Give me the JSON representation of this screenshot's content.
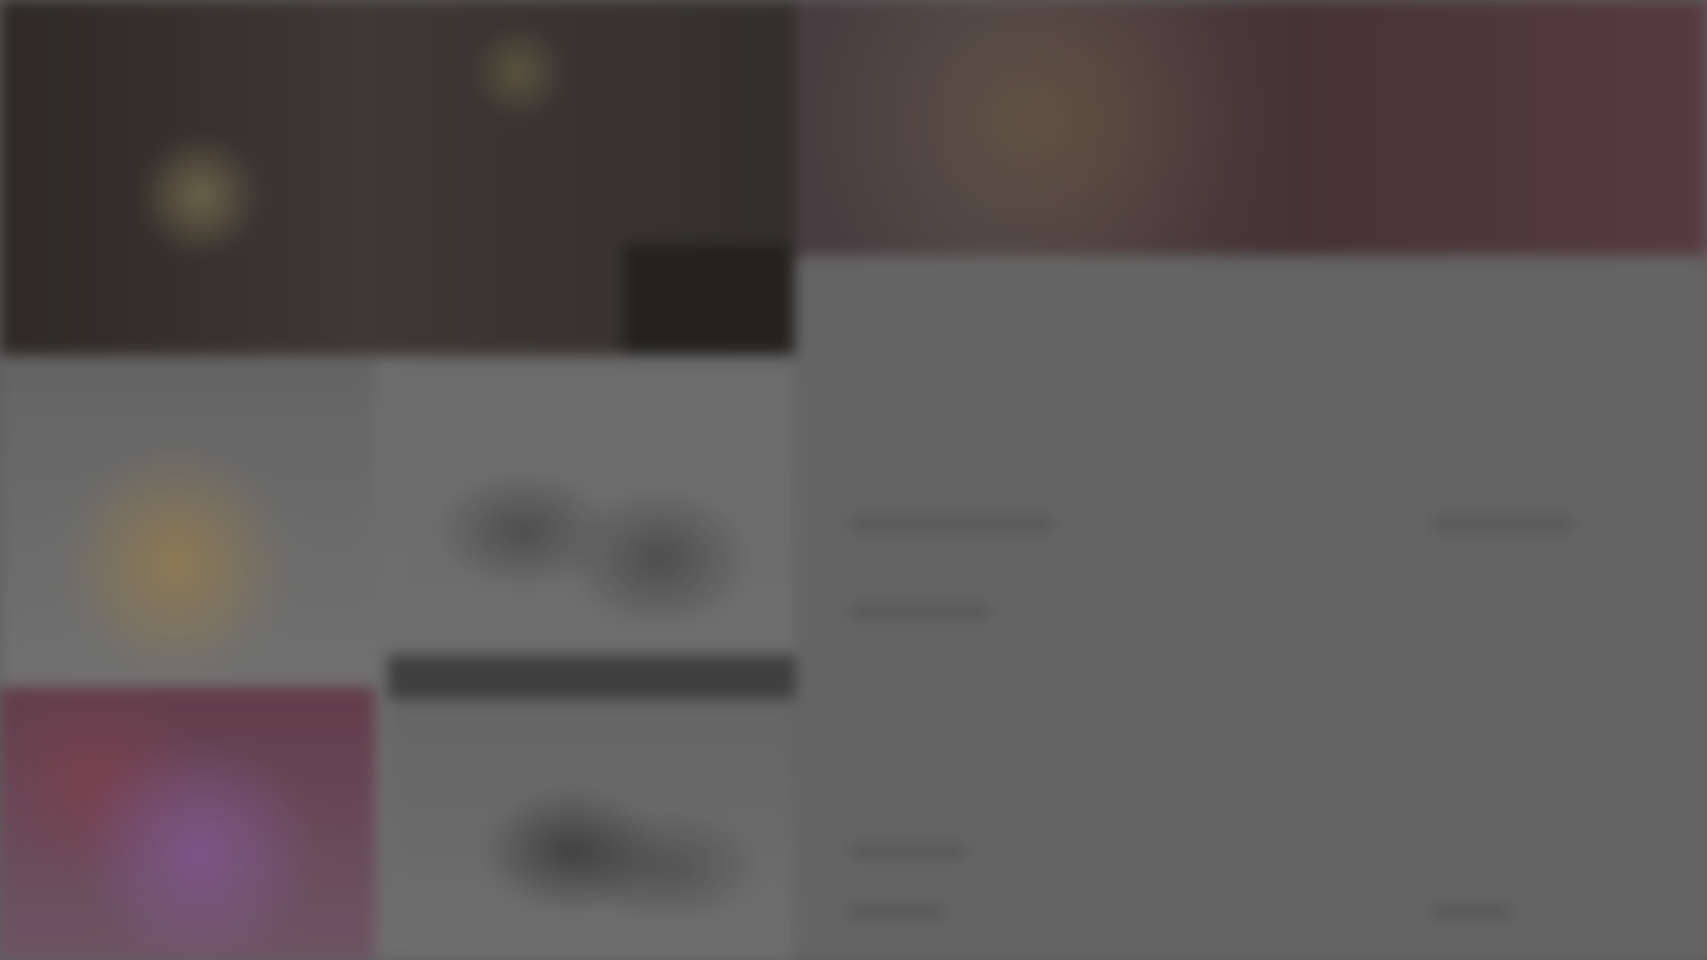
{
  "screen": {
    "title": "",
    "banner_text_large": "",
    "banner_text_small": ""
  },
  "details_panel": {
    "title": "",
    "sections": [
      {
        "label": ""
      },
      {
        "label": ""
      }
    ]
  },
  "colors": {
    "banner_dark": "#403934",
    "banner_red": "#6c4b52",
    "banner_gold": "#d7bf6b",
    "panel_gray": "#7f7f7f",
    "media_gray": "#8a8a8a",
    "accent_purple": "#a06eb4",
    "accent_pink": "#a05064"
  }
}
